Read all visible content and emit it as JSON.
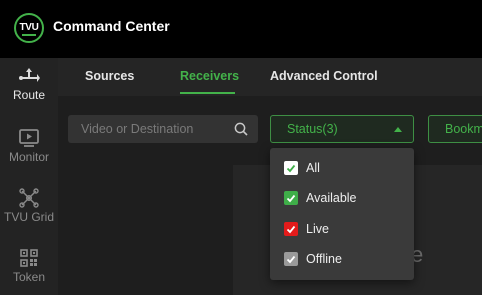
{
  "app": {
    "logo_text": "TVU",
    "title": "Command Center"
  },
  "rail": {
    "items": [
      {
        "label": "Route",
        "icon": "route-icon",
        "active": true
      },
      {
        "label": "Monitor",
        "icon": "monitor-icon",
        "active": false
      },
      {
        "label": "TVU Grid",
        "icon": "grid-network-icon",
        "active": false
      },
      {
        "label": "Token",
        "icon": "qr-code-icon",
        "active": false
      }
    ]
  },
  "tabs": [
    {
      "label": "Sources",
      "active": false
    },
    {
      "label": "Receivers",
      "active": true
    },
    {
      "label": "Advanced Control",
      "active": false
    }
  ],
  "toolbar": {
    "search_placeholder": "Video or Destination",
    "status_label": "Status(3)",
    "bookmark_label": "Bookmark"
  },
  "status_filter": {
    "options": [
      {
        "label": "All",
        "checked": true,
        "color": "#ffffff"
      },
      {
        "label": "Available",
        "checked": true,
        "color": "#3fae49"
      },
      {
        "label": "Live",
        "checked": true,
        "color": "#e31b1b"
      },
      {
        "label": "Offline",
        "checked": true,
        "color": "#9a9a9a"
      }
    ]
  },
  "panel": {
    "glyph": "e"
  },
  "colors": {
    "accent": "#43b24a",
    "topbar": "#000000",
    "background": "#1e1e1e"
  }
}
